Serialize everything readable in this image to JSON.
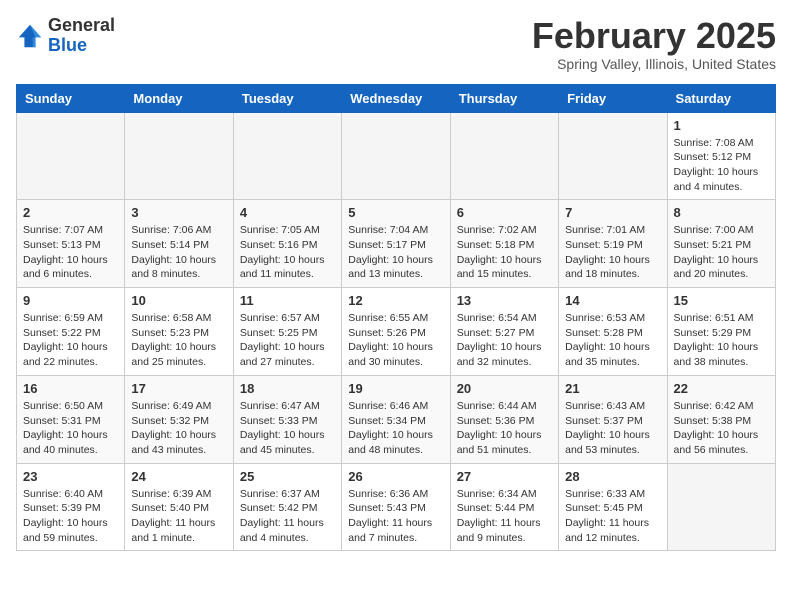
{
  "header": {
    "logo_general": "General",
    "logo_blue": "Blue",
    "month_title": "February 2025",
    "subtitle": "Spring Valley, Illinois, United States"
  },
  "days_of_week": [
    "Sunday",
    "Monday",
    "Tuesday",
    "Wednesday",
    "Thursday",
    "Friday",
    "Saturday"
  ],
  "weeks": [
    [
      {
        "day": "",
        "info": ""
      },
      {
        "day": "",
        "info": ""
      },
      {
        "day": "",
        "info": ""
      },
      {
        "day": "",
        "info": ""
      },
      {
        "day": "",
        "info": ""
      },
      {
        "day": "",
        "info": ""
      },
      {
        "day": "1",
        "info": "Sunrise: 7:08 AM\nSunset: 5:12 PM\nDaylight: 10 hours and 4 minutes."
      }
    ],
    [
      {
        "day": "2",
        "info": "Sunrise: 7:07 AM\nSunset: 5:13 PM\nDaylight: 10 hours and 6 minutes."
      },
      {
        "day": "3",
        "info": "Sunrise: 7:06 AM\nSunset: 5:14 PM\nDaylight: 10 hours and 8 minutes."
      },
      {
        "day": "4",
        "info": "Sunrise: 7:05 AM\nSunset: 5:16 PM\nDaylight: 10 hours and 11 minutes."
      },
      {
        "day": "5",
        "info": "Sunrise: 7:04 AM\nSunset: 5:17 PM\nDaylight: 10 hours and 13 minutes."
      },
      {
        "day": "6",
        "info": "Sunrise: 7:02 AM\nSunset: 5:18 PM\nDaylight: 10 hours and 15 minutes."
      },
      {
        "day": "7",
        "info": "Sunrise: 7:01 AM\nSunset: 5:19 PM\nDaylight: 10 hours and 18 minutes."
      },
      {
        "day": "8",
        "info": "Sunrise: 7:00 AM\nSunset: 5:21 PM\nDaylight: 10 hours and 20 minutes."
      }
    ],
    [
      {
        "day": "9",
        "info": "Sunrise: 6:59 AM\nSunset: 5:22 PM\nDaylight: 10 hours and 22 minutes."
      },
      {
        "day": "10",
        "info": "Sunrise: 6:58 AM\nSunset: 5:23 PM\nDaylight: 10 hours and 25 minutes."
      },
      {
        "day": "11",
        "info": "Sunrise: 6:57 AM\nSunset: 5:25 PM\nDaylight: 10 hours and 27 minutes."
      },
      {
        "day": "12",
        "info": "Sunrise: 6:55 AM\nSunset: 5:26 PM\nDaylight: 10 hours and 30 minutes."
      },
      {
        "day": "13",
        "info": "Sunrise: 6:54 AM\nSunset: 5:27 PM\nDaylight: 10 hours and 32 minutes."
      },
      {
        "day": "14",
        "info": "Sunrise: 6:53 AM\nSunset: 5:28 PM\nDaylight: 10 hours and 35 minutes."
      },
      {
        "day": "15",
        "info": "Sunrise: 6:51 AM\nSunset: 5:29 PM\nDaylight: 10 hours and 38 minutes."
      }
    ],
    [
      {
        "day": "16",
        "info": "Sunrise: 6:50 AM\nSunset: 5:31 PM\nDaylight: 10 hours and 40 minutes."
      },
      {
        "day": "17",
        "info": "Sunrise: 6:49 AM\nSunset: 5:32 PM\nDaylight: 10 hours and 43 minutes."
      },
      {
        "day": "18",
        "info": "Sunrise: 6:47 AM\nSunset: 5:33 PM\nDaylight: 10 hours and 45 minutes."
      },
      {
        "day": "19",
        "info": "Sunrise: 6:46 AM\nSunset: 5:34 PM\nDaylight: 10 hours and 48 minutes."
      },
      {
        "day": "20",
        "info": "Sunrise: 6:44 AM\nSunset: 5:36 PM\nDaylight: 10 hours and 51 minutes."
      },
      {
        "day": "21",
        "info": "Sunrise: 6:43 AM\nSunset: 5:37 PM\nDaylight: 10 hours and 53 minutes."
      },
      {
        "day": "22",
        "info": "Sunrise: 6:42 AM\nSunset: 5:38 PM\nDaylight: 10 hours and 56 minutes."
      }
    ],
    [
      {
        "day": "23",
        "info": "Sunrise: 6:40 AM\nSunset: 5:39 PM\nDaylight: 10 hours and 59 minutes."
      },
      {
        "day": "24",
        "info": "Sunrise: 6:39 AM\nSunset: 5:40 PM\nDaylight: 11 hours and 1 minute."
      },
      {
        "day": "25",
        "info": "Sunrise: 6:37 AM\nSunset: 5:42 PM\nDaylight: 11 hours and 4 minutes."
      },
      {
        "day": "26",
        "info": "Sunrise: 6:36 AM\nSunset: 5:43 PM\nDaylight: 11 hours and 7 minutes."
      },
      {
        "day": "27",
        "info": "Sunrise: 6:34 AM\nSunset: 5:44 PM\nDaylight: 11 hours and 9 minutes."
      },
      {
        "day": "28",
        "info": "Sunrise: 6:33 AM\nSunset: 5:45 PM\nDaylight: 11 hours and 12 minutes."
      },
      {
        "day": "",
        "info": ""
      }
    ]
  ]
}
